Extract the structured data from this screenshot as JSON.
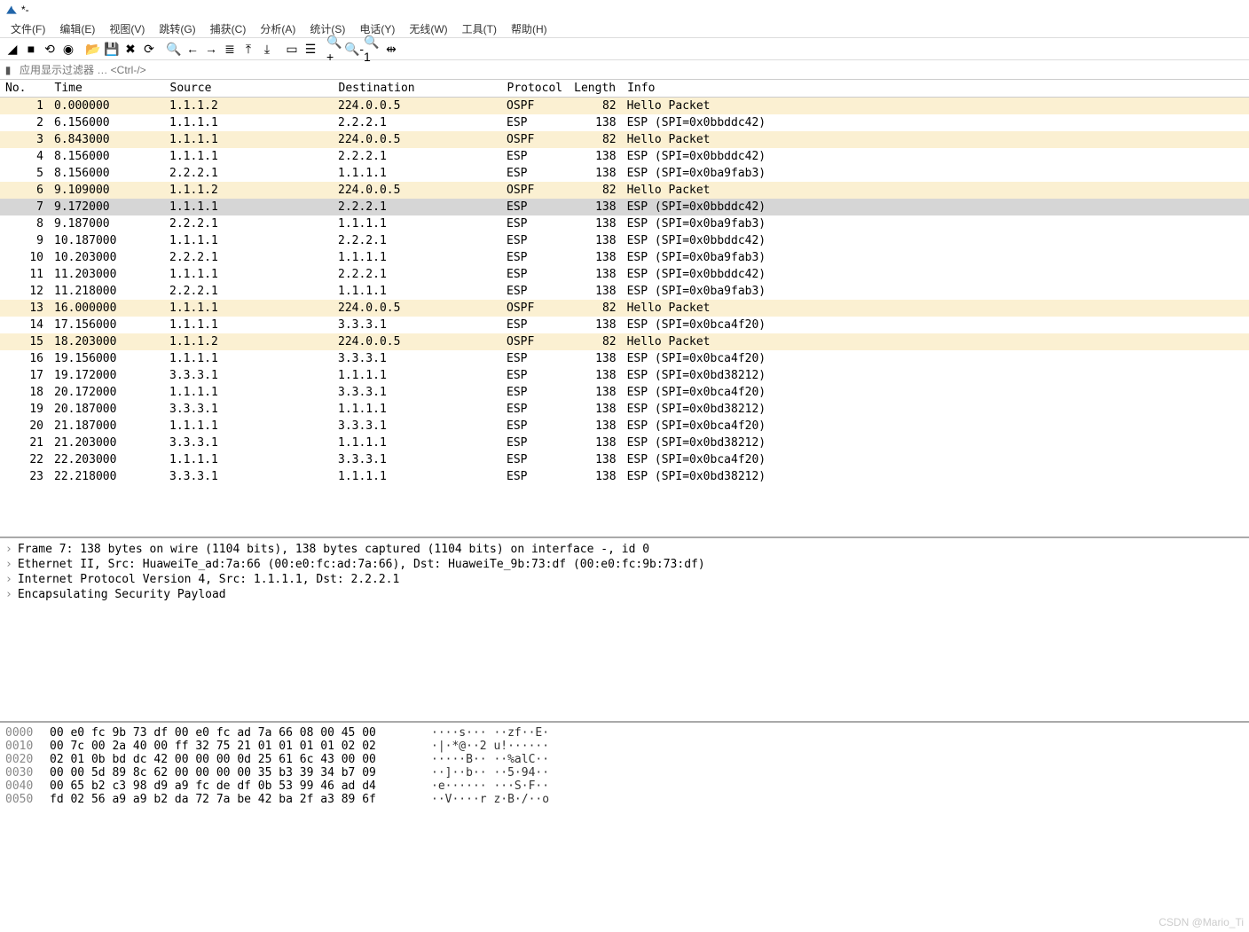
{
  "title": "*-",
  "menu": [
    "文件(F)",
    "编辑(E)",
    "视图(V)",
    "跳转(G)",
    "捕获(C)",
    "分析(A)",
    "统计(S)",
    "电话(Y)",
    "无线(W)",
    "工具(T)",
    "帮助(H)"
  ],
  "filter_placeholder": "应用显示过滤器 … <Ctrl-/>",
  "columns": [
    "No.",
    "Time",
    "Source",
    "Destination",
    "Protocol",
    "Length",
    "Info"
  ],
  "packets": [
    {
      "no": 1,
      "time": "0.000000",
      "src": "1.1.1.2",
      "dst": "224.0.0.5",
      "proto": "OSPF",
      "len": 82,
      "info": "Hello Packet",
      "cls": "ospf"
    },
    {
      "no": 2,
      "time": "6.156000",
      "src": "1.1.1.1",
      "dst": "2.2.2.1",
      "proto": "ESP",
      "len": 138,
      "info": "ESP (SPI=0x0bbddc42)"
    },
    {
      "no": 3,
      "time": "6.843000",
      "src": "1.1.1.1",
      "dst": "224.0.0.5",
      "proto": "OSPF",
      "len": 82,
      "info": "Hello Packet",
      "cls": "ospf"
    },
    {
      "no": 4,
      "time": "8.156000",
      "src": "1.1.1.1",
      "dst": "2.2.2.1",
      "proto": "ESP",
      "len": 138,
      "info": "ESP (SPI=0x0bbddc42)"
    },
    {
      "no": 5,
      "time": "8.156000",
      "src": "2.2.2.1",
      "dst": "1.1.1.1",
      "proto": "ESP",
      "len": 138,
      "info": "ESP (SPI=0x0ba9fab3)"
    },
    {
      "no": 6,
      "time": "9.109000",
      "src": "1.1.1.2",
      "dst": "224.0.0.5",
      "proto": "OSPF",
      "len": 82,
      "info": "Hello Packet",
      "cls": "ospf"
    },
    {
      "no": 7,
      "time": "9.172000",
      "src": "1.1.1.1",
      "dst": "2.2.2.1",
      "proto": "ESP",
      "len": 138,
      "info": "ESP (SPI=0x0bbddc42)",
      "cls": "selected"
    },
    {
      "no": 8,
      "time": "9.187000",
      "src": "2.2.2.1",
      "dst": "1.1.1.1",
      "proto": "ESP",
      "len": 138,
      "info": "ESP (SPI=0x0ba9fab3)"
    },
    {
      "no": 9,
      "time": "10.187000",
      "src": "1.1.1.1",
      "dst": "2.2.2.1",
      "proto": "ESP",
      "len": 138,
      "info": "ESP (SPI=0x0bbddc42)"
    },
    {
      "no": 10,
      "time": "10.203000",
      "src": "2.2.2.1",
      "dst": "1.1.1.1",
      "proto": "ESP",
      "len": 138,
      "info": "ESP (SPI=0x0ba9fab3)"
    },
    {
      "no": 11,
      "time": "11.203000",
      "src": "1.1.1.1",
      "dst": "2.2.2.1",
      "proto": "ESP",
      "len": 138,
      "info": "ESP (SPI=0x0bbddc42)"
    },
    {
      "no": 12,
      "time": "11.218000",
      "src": "2.2.2.1",
      "dst": "1.1.1.1",
      "proto": "ESP",
      "len": 138,
      "info": "ESP (SPI=0x0ba9fab3)"
    },
    {
      "no": 13,
      "time": "16.000000",
      "src": "1.1.1.1",
      "dst": "224.0.0.5",
      "proto": "OSPF",
      "len": 82,
      "info": "Hello Packet",
      "cls": "ospf"
    },
    {
      "no": 14,
      "time": "17.156000",
      "src": "1.1.1.1",
      "dst": "3.3.3.1",
      "proto": "ESP",
      "len": 138,
      "info": "ESP (SPI=0x0bca4f20)"
    },
    {
      "no": 15,
      "time": "18.203000",
      "src": "1.1.1.2",
      "dst": "224.0.0.5",
      "proto": "OSPF",
      "len": 82,
      "info": "Hello Packet",
      "cls": "ospf"
    },
    {
      "no": 16,
      "time": "19.156000",
      "src": "1.1.1.1",
      "dst": "3.3.3.1",
      "proto": "ESP",
      "len": 138,
      "info": "ESP (SPI=0x0bca4f20)"
    },
    {
      "no": 17,
      "time": "19.172000",
      "src": "3.3.3.1",
      "dst": "1.1.1.1",
      "proto": "ESP",
      "len": 138,
      "info": "ESP (SPI=0x0bd38212)"
    },
    {
      "no": 18,
      "time": "20.172000",
      "src": "1.1.1.1",
      "dst": "3.3.3.1",
      "proto": "ESP",
      "len": 138,
      "info": "ESP (SPI=0x0bca4f20)"
    },
    {
      "no": 19,
      "time": "20.187000",
      "src": "3.3.3.1",
      "dst": "1.1.1.1",
      "proto": "ESP",
      "len": 138,
      "info": "ESP (SPI=0x0bd38212)"
    },
    {
      "no": 20,
      "time": "21.187000",
      "src": "1.1.1.1",
      "dst": "3.3.3.1",
      "proto": "ESP",
      "len": 138,
      "info": "ESP (SPI=0x0bca4f20)"
    },
    {
      "no": 21,
      "time": "21.203000",
      "src": "3.3.3.1",
      "dst": "1.1.1.1",
      "proto": "ESP",
      "len": 138,
      "info": "ESP (SPI=0x0bd38212)"
    },
    {
      "no": 22,
      "time": "22.203000",
      "src": "1.1.1.1",
      "dst": "3.3.3.1",
      "proto": "ESP",
      "len": 138,
      "info": "ESP (SPI=0x0bca4f20)"
    },
    {
      "no": 23,
      "time": "22.218000",
      "src": "3.3.3.1",
      "dst": "1.1.1.1",
      "proto": "ESP",
      "len": 138,
      "info": "ESP (SPI=0x0bd38212)"
    }
  ],
  "details": [
    "Frame 7: 138 bytes on wire (1104 bits), 138 bytes captured (1104 bits) on interface -, id 0",
    "Ethernet II, Src: HuaweiTe_ad:7a:66 (00:e0:fc:ad:7a:66), Dst: HuaweiTe_9b:73:df (00:e0:fc:9b:73:df)",
    "Internet Protocol Version 4, Src: 1.1.1.1, Dst: 2.2.2.1",
    "Encapsulating Security Payload"
  ],
  "bytes": [
    {
      "off": "0000",
      "hex": "00 e0 fc 9b 73 df 00 e0  fc ad 7a 66 08 00 45 00",
      "asc": "····s··· ··zf··E·"
    },
    {
      "off": "0010",
      "hex": "00 7c 00 2a 40 00 ff 32  75 21 01 01 01 01 02 02",
      "asc": "·|·*@··2 u!······"
    },
    {
      "off": "0020",
      "hex": "02 01 0b bd dc 42 00 00  00 0d 25 61 6c 43 00 00",
      "asc": "·····B·· ··%alC··"
    },
    {
      "off": "0030",
      "hex": "00 00 5d 89 8c 62 00 00  00 00 35 b3 39 34 b7 09",
      "asc": "··]··b·· ··5·94··"
    },
    {
      "off": "0040",
      "hex": "00 65 b2 c3 98 d9 a9 fc  de df 0b 53 99 46 ad d4",
      "asc": "·e······ ···S·F··"
    },
    {
      "off": "0050",
      "hex": "fd 02 56 a9 a9 b2 da 72  7a be 42 ba 2f a3 89 6f",
      "asc": "··V····r z·B·/··o"
    }
  ],
  "watermark": "CSDN @Mario_Ti",
  "toolbar_icons": [
    "shark-fin-icon",
    "stop-icon",
    "restart-icon",
    "options-icon",
    "folder-open-icon",
    "save-icon",
    "close-icon",
    "reload-icon",
    "find-icon",
    "back-icon",
    "forward-icon",
    "jump-icon",
    "go-first-icon",
    "go-last-icon",
    "autoscroll-icon",
    "colorize-icon",
    "zoom-in-icon",
    "zoom-out-icon",
    "zoom-reset-icon",
    "resize-columns-icon"
  ],
  "toolbar_glyphs": [
    "◢",
    "■",
    "⟲",
    "◉",
    "📂",
    "💾",
    "✖",
    "⟳",
    "🔍",
    "←",
    "→",
    "≣",
    "⤒",
    "⤓",
    "▭",
    "☰",
    "🔍+",
    "🔍-",
    "🔍1",
    "⇹"
  ]
}
